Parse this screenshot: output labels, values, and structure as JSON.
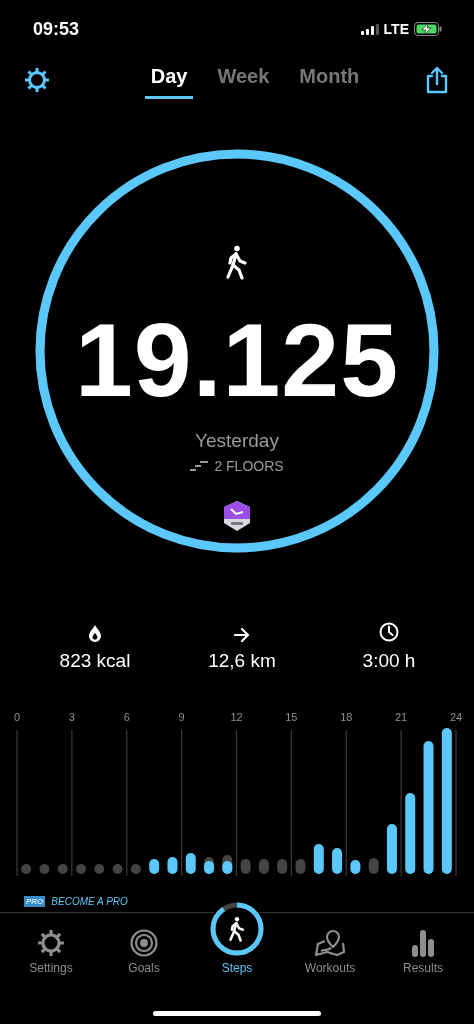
{
  "status_bar": {
    "time": "09:53",
    "network": "LTE",
    "charging": true
  },
  "tabs": [
    {
      "label": "Day",
      "selected": true
    },
    {
      "label": "Week",
      "selected": false
    },
    {
      "label": "Month",
      "selected": false
    }
  ],
  "summary": {
    "steps": "19.125",
    "day": "Yesterday",
    "floors": "2 FLOORS"
  },
  "stats": [
    {
      "kind": "energy",
      "value": "823 kcal"
    },
    {
      "kind": "distance",
      "value": "12,6 km"
    },
    {
      "kind": "time",
      "value": "3:00 h"
    }
  ],
  "hour_labels": [
    "0",
    "3",
    "6",
    "9",
    "12",
    "15",
    "18",
    "21",
    "24"
  ],
  "promo": {
    "badge": "PRO",
    "text": "BECOME A PRO"
  },
  "nav": [
    {
      "kind": "gear",
      "label": "Settings",
      "selected": false
    },
    {
      "kind": "target",
      "label": "Goals",
      "selected": false
    },
    {
      "kind": "steps",
      "label": "Steps",
      "selected": true
    },
    {
      "kind": "map",
      "label": "Workouts",
      "selected": false
    },
    {
      "kind": "bars",
      "label": "Results",
      "selected": false
    }
  ]
}
